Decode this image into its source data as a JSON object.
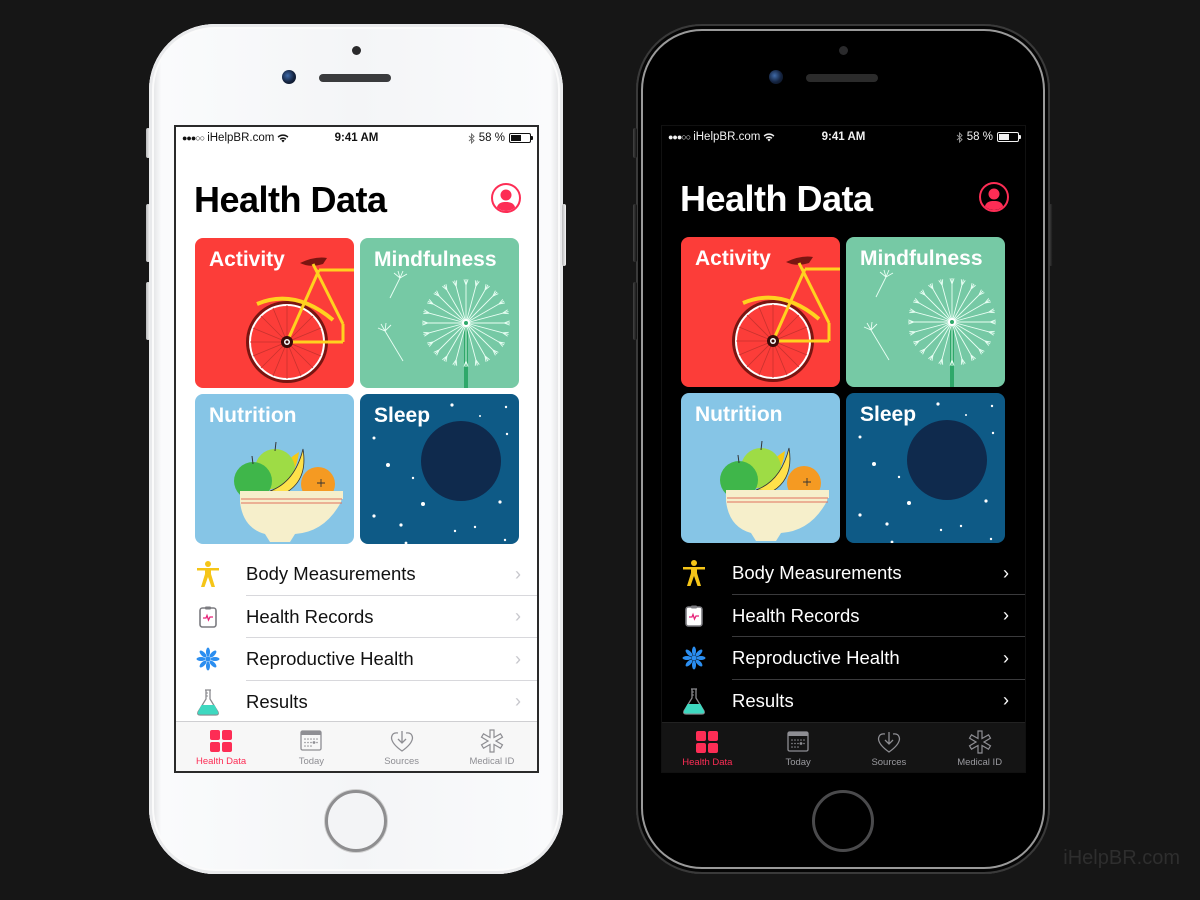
{
  "watermark": "iHelpBR.com",
  "colors": {
    "accent": "#fd2d55",
    "activity": "#fc3d39",
    "mindfulness": "#76c9a5",
    "nutrition": "#86c5e6",
    "sleep": "#0e5a86",
    "body_icon": "#f5c518",
    "repro_icon": "#2b8ef0",
    "results_icon": "#3ed8c0"
  },
  "phones": [
    {
      "theme": "light",
      "status": {
        "carrier": "iHelpBR.com",
        "signal": "●●●○○",
        "time": "9:41 AM",
        "battery_text": "58 %",
        "battery_level": 0.58
      },
      "title": "Health Data",
      "tiles": [
        {
          "label": "Activity"
        },
        {
          "label": "Mindfulness"
        },
        {
          "label": "Nutrition"
        },
        {
          "label": "Sleep"
        }
      ],
      "list": [
        {
          "label": "Body Measurements",
          "icon": "body-figure-icon"
        },
        {
          "label": "Health Records",
          "icon": "health-records-icon"
        },
        {
          "label": "Reproductive Health",
          "icon": "reproductive-snowflake-icon"
        },
        {
          "label": "Results",
          "icon": "flask-icon"
        }
      ],
      "tabs": [
        {
          "label": "Health Data",
          "active": true
        },
        {
          "label": "Today",
          "active": false
        },
        {
          "label": "Sources",
          "active": false
        },
        {
          "label": "Medical ID",
          "active": false
        }
      ]
    },
    {
      "theme": "dark",
      "status": {
        "carrier": "iHelpBR.com",
        "signal": "●●●○○",
        "time": "9:41 AM",
        "battery_text": "58 %",
        "battery_level": 0.58
      },
      "title": "Health Data",
      "tiles": [
        {
          "label": "Activity"
        },
        {
          "label": "Mindfulness"
        },
        {
          "label": "Nutrition"
        },
        {
          "label": "Sleep"
        }
      ],
      "list": [
        {
          "label": "Body Measurements",
          "icon": "body-figure-icon"
        },
        {
          "label": "Health Records",
          "icon": "health-records-icon"
        },
        {
          "label": "Reproductive Health",
          "icon": "reproductive-snowflake-icon"
        },
        {
          "label": "Results",
          "icon": "flask-icon"
        }
      ],
      "tabs": [
        {
          "label": "Health Data",
          "active": true
        },
        {
          "label": "Today",
          "active": false
        },
        {
          "label": "Sources",
          "active": false
        },
        {
          "label": "Medical ID",
          "active": false
        }
      ]
    }
  ]
}
